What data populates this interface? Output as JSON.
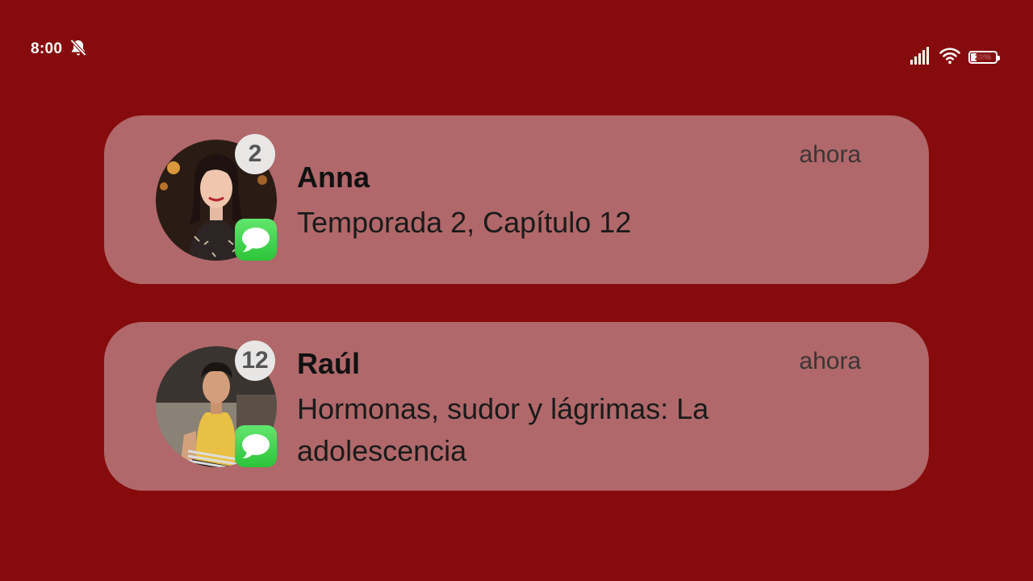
{
  "status_bar": {
    "time": "8:00",
    "mute_icon": "bell-off-icon",
    "signal_icon": "cellular-signal-icon",
    "wifi_icon": "wifi-icon",
    "battery_level": 0.23,
    "battery_label": "23%"
  },
  "notifications": [
    {
      "sender": "Anna",
      "message": "Temporada 2, Capítulo 12",
      "time": "ahora",
      "count": "2",
      "app_icon": "messages-app-icon"
    },
    {
      "sender": "Raúl",
      "message": "Hormonas, sudor y lágrimas: La adolescencia",
      "time": "ahora",
      "count": "12",
      "app_icon": "messages-app-icon"
    }
  ],
  "colors": {
    "background": "#860b0d",
    "card": "#b0686a",
    "messages_green": "#34c759"
  }
}
